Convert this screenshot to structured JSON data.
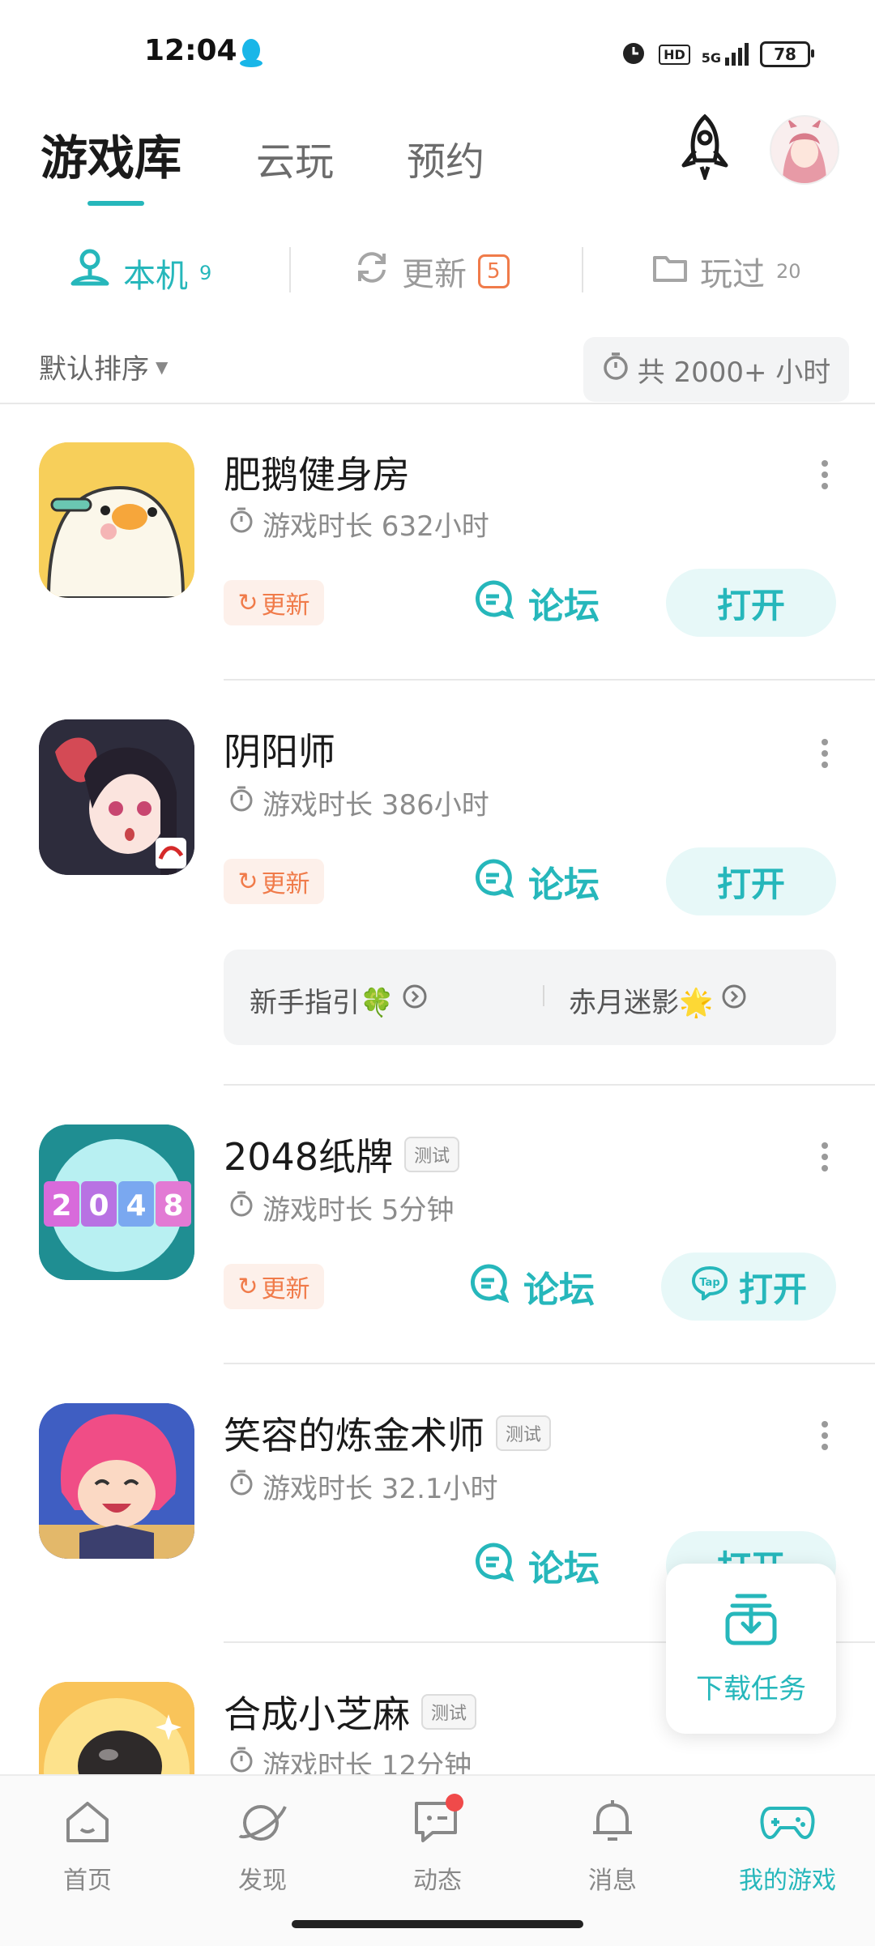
{
  "status": {
    "time": "12:04",
    "hd": "HD",
    "net": "5G",
    "battery": "78"
  },
  "tabs": {
    "library": "游戏库",
    "cloud": "云玩",
    "reserve": "预约"
  },
  "subtabs": {
    "local": {
      "label": "本机",
      "count": "9"
    },
    "update": {
      "label": "更新",
      "count": "5"
    },
    "played": {
      "label": "玩过",
      "count": "20"
    }
  },
  "sort_label": "默认排序",
  "total_time": "共 2000+ 小时",
  "common": {
    "update": "更新",
    "forum": "论坛",
    "open": "打开",
    "test": "测试"
  },
  "games": [
    {
      "name": "肥鹅健身房",
      "duration": "游戏时长 632小时"
    },
    {
      "name": "阴阳师",
      "duration": "游戏时长 386小时"
    },
    {
      "name": "2048纸牌",
      "duration": "游戏时长 5分钟"
    },
    {
      "name": "笑容的炼金术师",
      "duration": "游戏时长 32.1小时"
    },
    {
      "name": "合成小芝麻",
      "duration": "游戏时长 12分钟"
    }
  ],
  "guides": [
    {
      "label": "新手指引🍀"
    },
    {
      "label": "赤月迷影🌟"
    }
  ],
  "icon2048": [
    "2",
    "0",
    "4",
    "8"
  ],
  "tap_logo": "Tap",
  "download_task": "下载任务",
  "nav": {
    "home": "首页",
    "discover": "发现",
    "feed": "动态",
    "messages": "消息",
    "mygames": "我的游戏"
  },
  "colors": {
    "accent": "#26b7bb",
    "update": "#f07b4a"
  }
}
